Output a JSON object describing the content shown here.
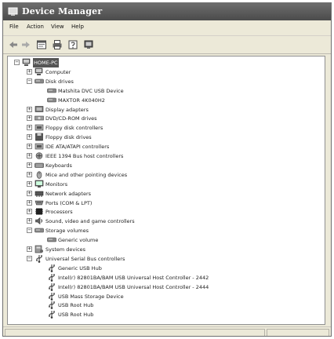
{
  "window": {
    "title": "Device Manager"
  },
  "menu": [
    {
      "label": "File"
    },
    {
      "label": "Action"
    },
    {
      "label": "View"
    },
    {
      "label": "Help"
    }
  ],
  "tree": [
    {
      "label": "HOME-PC",
      "depth": 0,
      "expander": "minus",
      "icon": "computer-icon",
      "selected": true
    },
    {
      "label": "Computer",
      "depth": 1,
      "expander": "plus",
      "icon": "computer-icon"
    },
    {
      "label": "Disk drives",
      "depth": 1,
      "expander": "minus",
      "icon": "disk-drive-icon"
    },
    {
      "label": "Matshita DVC USB Device",
      "depth": 2,
      "icon": "disk-drive-icon"
    },
    {
      "label": "MAXTOR 4K040H2",
      "depth": 2,
      "icon": "disk-drive-icon"
    },
    {
      "label": "Display adapters",
      "depth": 1,
      "expander": "plus",
      "icon": "display-icon"
    },
    {
      "label": "DVD/CD-ROM drives",
      "depth": 1,
      "expander": "plus",
      "icon": "cdrom-icon"
    },
    {
      "label": "Floppy disk controllers",
      "depth": 1,
      "expander": "plus",
      "icon": "controller-icon"
    },
    {
      "label": "Floppy disk drives",
      "depth": 1,
      "expander": "plus",
      "icon": "floppy-icon"
    },
    {
      "label": "IDE ATA/ATAPI controllers",
      "depth": 1,
      "expander": "plus",
      "icon": "controller-icon"
    },
    {
      "label": "IEEE 1394 Bus host controllers",
      "depth": 1,
      "expander": "plus",
      "icon": "firewire-icon"
    },
    {
      "label": "Keyboards",
      "depth": 1,
      "expander": "plus",
      "icon": "keyboard-icon"
    },
    {
      "label": "Mice and other pointing devices",
      "depth": 1,
      "expander": "plus",
      "icon": "mouse-icon"
    },
    {
      "label": "Monitors",
      "depth": 1,
      "expander": "plus",
      "icon": "monitor-icon"
    },
    {
      "label": "Network adapters",
      "depth": 1,
      "expander": "plus",
      "icon": "network-icon"
    },
    {
      "label": "Ports (COM & LPT)",
      "depth": 1,
      "expander": "plus",
      "icon": "port-icon"
    },
    {
      "label": "Processors",
      "depth": 1,
      "expander": "plus",
      "icon": "processor-icon"
    },
    {
      "label": "Sound, video and game controllers",
      "depth": 1,
      "expander": "plus",
      "icon": "sound-icon"
    },
    {
      "label": "Storage volumes",
      "depth": 1,
      "expander": "minus",
      "icon": "disk-drive-icon"
    },
    {
      "label": "Generic volume",
      "depth": 2,
      "icon": "disk-drive-icon"
    },
    {
      "label": "System devices",
      "depth": 1,
      "expander": "plus",
      "icon": "system-icon"
    },
    {
      "label": "Universal Serial Bus controllers",
      "depth": 1,
      "expander": "minus",
      "icon": "usb-icon"
    },
    {
      "label": "Generic USB Hub",
      "depth": 2,
      "icon": "usb-icon"
    },
    {
      "label": "Intel(r) 82801BA/BAM USB Universal Host Controller - 2442",
      "depth": 2,
      "icon": "usb-icon"
    },
    {
      "label": "Intel(r) 82801BA/BAM USB Universal Host Controller - 2444",
      "depth": 2,
      "icon": "usb-icon"
    },
    {
      "label": "USB Mass Storage Device",
      "depth": 2,
      "icon": "usb-icon"
    },
    {
      "label": "USB Root Hub",
      "depth": 2,
      "icon": "usb-icon"
    },
    {
      "label": "USB Root Hub",
      "depth": 2,
      "icon": "usb-icon"
    }
  ]
}
